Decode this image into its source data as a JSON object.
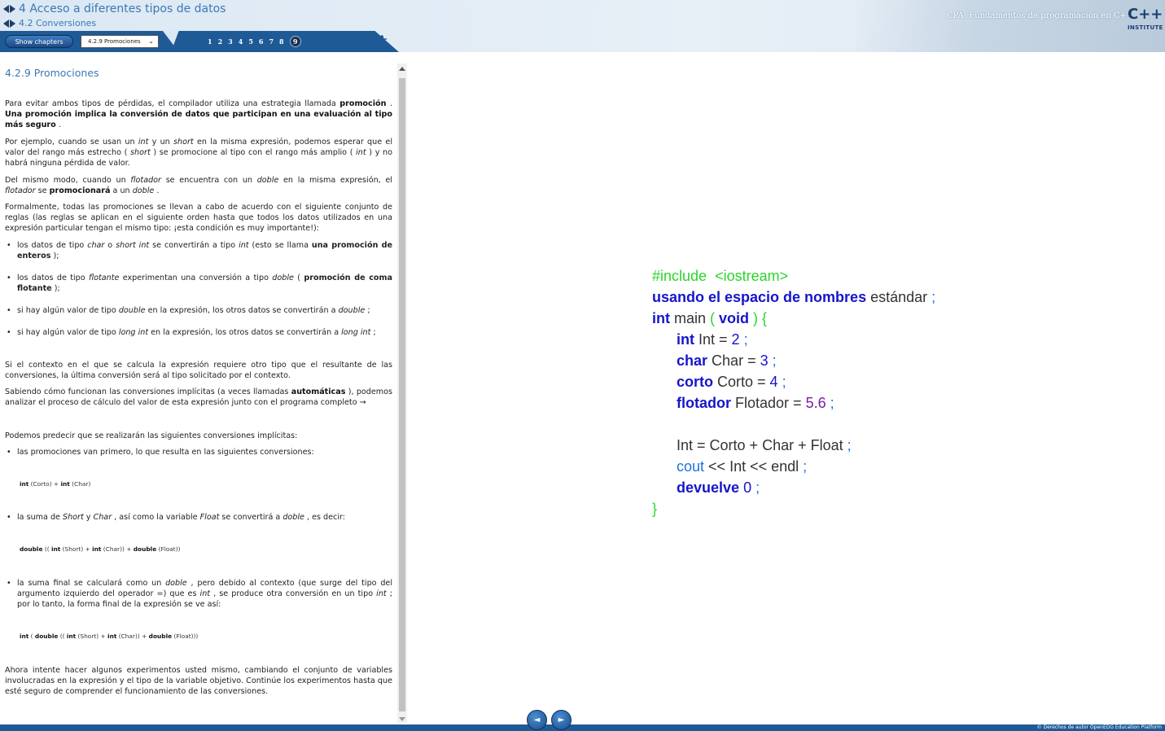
{
  "header": {
    "crumb1": "4 Acceso a diferentes tipos de datos",
    "crumb2": "4.2 Conversiones",
    "show_chapters": "Show chapters",
    "select_value": "4.2.9 Promociones",
    "pages": [
      "1",
      "2",
      "3",
      "4",
      "5",
      "6",
      "7",
      "8",
      "9"
    ],
    "active_page": "9",
    "course_title": "CPA: Fundamentos de programación en C++",
    "logo_cpp": "C++",
    "logo_inst": "INSTITUTE"
  },
  "content": {
    "section_title": "4.2.9 Promociones",
    "p1a": "Para evitar ambos tipos de pérdidas, el compilador utiliza una estrategia llamada ",
    "p1b": "promoción",
    "p1c": " . ",
    "p1d": "Una promoción implica la conversión de datos que participan en una evaluación al tipo más seguro",
    "p1e": " .",
    "p2a": "Por ejemplo, cuando se usan un ",
    "p2b": "int",
    "p2c": " y un ",
    "p2d": "short",
    "p2e": " en la misma expresión, podemos esperar que el valor del rango más estrecho ( ",
    "p2f": "short",
    "p2g": " ) se promocione al tipo con el rango más amplio ( ",
    "p2h": "int",
    "p2i": " ) y no habrá ninguna pérdida de valor.",
    "p3a": "Del mismo modo, cuando un ",
    "p3b": "flotador",
    "p3c": " se encuentra con un ",
    "p3d": "doble",
    "p3e": " en la misma expresión, el ",
    "p3f": "flotador",
    "p3g": " se ",
    "p3h": "promocionará",
    "p3i": " a un ",
    "p3j": "doble",
    "p3k": " .",
    "p4": "Formalmente, todas las promociones se llevan a cabo de acuerdo con el siguiente conjunto de reglas (las reglas se aplican en el siguiente orden hasta que todos los datos utilizados en una expresión particular tengan el mismo tipo: ¡esta condición es muy importante!):",
    "b1a": "los datos de tipo ",
    "b1b": "char",
    "b1c": " o ",
    "b1d": "short int",
    "b1e": " se convertirán a tipo ",
    "b1f": "int",
    "b1g": " (esto se llama ",
    "b1h": "una promoción de enteros",
    "b1i": " );",
    "b2a": "los datos de tipo ",
    "b2b": "flotante",
    "b2c": " experimentan una conversión a tipo ",
    "b2d": "doble",
    "b2e": " ( ",
    "b2f": "promoción de coma flotante",
    "b2g": " );",
    "b3a": "si hay algún valor de tipo ",
    "b3b": "double",
    "b3c": " en la expresión, los otros datos se convertirán a ",
    "b3d": "double",
    "b3e": " ;",
    "b4a": "si hay algún valor de tipo ",
    "b4b": "long int",
    "b4c": " en la expresión, los otros datos se convertirán a ",
    "b4d": "long int",
    "b4e": " ;",
    "p5": "Si el contexto en el que se calcula la expresión requiere otro tipo que el resultante de las conversiones, la última conversión será al tipo solicitado por el contexto.",
    "p6a": "Sabiendo cómo funcionan las conversiones implícitas (a veces llamadas ",
    "p6b": "automáticas",
    "p6c": " ), podemos analizar el proceso de cálculo del valor de esta expresión junto con el programa completo →",
    "p7": "Podemos predecir que se realizarán las siguientes conversiones implícitas:",
    "b5": "las promociones van primero, lo que resulta en las siguientes conversiones:",
    "c1a": "int",
    "c1b": " (Corto) + ",
    "c1c": "int",
    "c1d": " (Char)",
    "b6a": "la suma de ",
    "b6b": "Short",
    "b6c": " y ",
    "b6d": "Char",
    "b6e": " , así como la variable ",
    "b6f": "Float",
    "b6g": " se convertirá a ",
    "b6h": "doble",
    "b6i": " , es decir:",
    "c2a": "double",
    "c2b": " (( ",
    "c2c": "int",
    "c2d": " (Short) + ",
    "c2e": "int",
    "c2f": " (Char)) + ",
    "c2g": "double",
    "c2h": " (Float))",
    "b7a": "la suma final se calculará como un ",
    "b7b": "doble",
    "b7c": " , pero debido al contexto (que surge del tipo del argumento izquierdo del operador =) que es ",
    "b7d": "int",
    "b7e": " , se produce otra conversión en un tipo ",
    "b7f": "int",
    "b7g": " ; por lo tanto, la forma final de la expresión se ve así:",
    "c3a": "int",
    "c3b": " ( ",
    "c3c": "double",
    "c3d": " (( ",
    "c3e": "int",
    "c3f": " (Short) + ",
    "c3g": "int",
    "c3h": " (Char)) + ",
    "c3i": "double",
    "c3j": " (Float)))",
    "p8": "Ahora intente hacer algunos experimentos usted mismo, cambiando el conjunto de variables involucradas en la expresión y el tipo de la variable objetivo. Continúe los experimentos hasta que esté seguro de comprender el funcionamiento de las conversiones."
  },
  "code": {
    "l1a": "#include",
    "l1b": "<iostream>",
    "l2a": "usando el espacio de nombres",
    "l2b": " estándar ",
    "l2c": ";",
    "l3a": "int",
    "l3b": " main ",
    "l3c": "( ",
    "l3d": "void",
    "l3e": " ) {",
    "l4a": "int",
    "l4b": " Int = ",
    "l4c": "2",
    "l4d": " ;",
    "l5a": "char",
    "l5b": " Char = ",
    "l5c": "3",
    "l5d": " ;",
    "l6a": "corto",
    "l6b": " Corto = ",
    "l6c": "4",
    "l6d": " ;",
    "l7a": "flotador",
    "l7b": " Flotador = ",
    "l7c": "5.6",
    "l7d": " ;",
    "l8a": "Int = Corto + Char + Float",
    "l8b": " ;",
    "l9a": "cout",
    "l9b": " << Int << endl ",
    "l9c": ";",
    "l10a": "devuelve",
    "l10b": " 0",
    "l10c": " ;",
    "l11": "}"
  },
  "footer": {
    "copyright": "© Derechos de autor OpenEDG Education Platform",
    "prev": "◄",
    "next": "►"
  },
  "colors": {
    "accent": "#3c78b5",
    "navbar": "#1e5a96",
    "keyword": "#1515cc",
    "preprocessor": "#2bd42b",
    "float_literal": "#7a1fa2"
  }
}
